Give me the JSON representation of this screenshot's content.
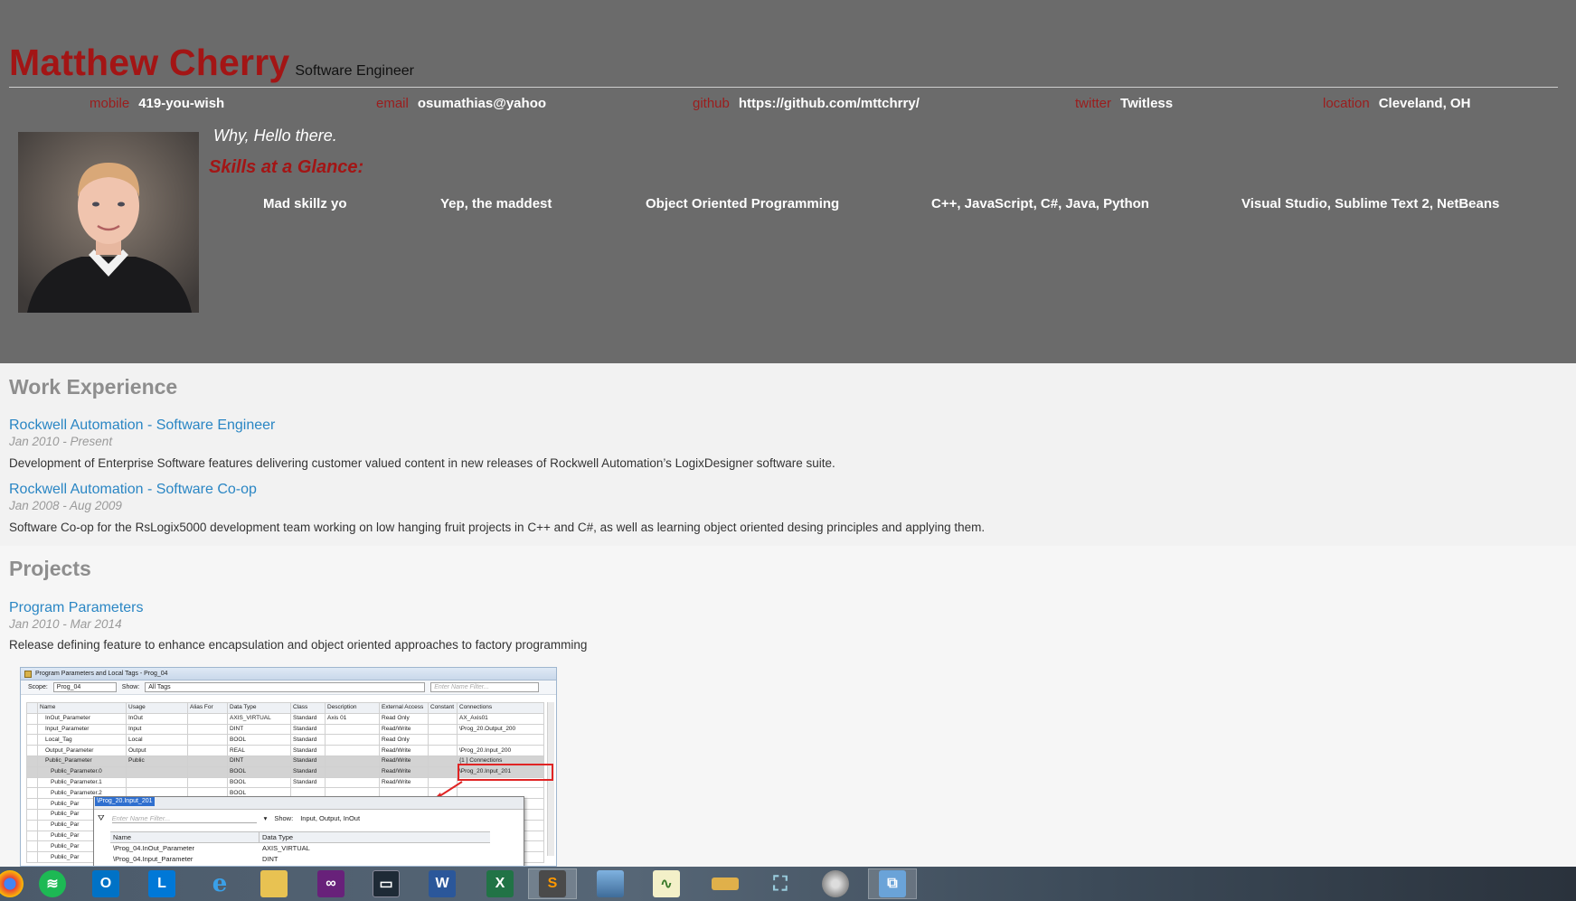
{
  "header": {
    "name": "Matthew Cherry",
    "role": "Software Engineer",
    "contacts": [
      {
        "label": "mobile",
        "value": "419-you-wish"
      },
      {
        "label": "email",
        "value": "osumathias@yahoo"
      },
      {
        "label": "github",
        "value": "https://github.com/mttchrry/"
      },
      {
        "label": "twitter",
        "value": "Twitless"
      },
      {
        "label": "location",
        "value": "Cleveland, OH"
      }
    ],
    "greeting": "Why, Hello there.",
    "skills_title": "Skills at a Glance:",
    "skills": [
      "Mad skillz yo",
      "Yep, the maddest",
      "Object Oriented Programming",
      "C++, JavaScript, C#, Java, Python",
      "Visual Studio, Sublime Text 2, NetBeans"
    ]
  },
  "work": {
    "title": "Work Experience",
    "items": [
      {
        "title": "Rockwell Automation - Software Engineer",
        "date": "Jan 2010 - Present",
        "description": "Development of Enterprise Software features delivering customer valued content in new releases of Rockwell Automation’s LogixDesigner software suite."
      },
      {
        "title": "Rockwell Automation - Software Co-op",
        "date": "Jan 2008 - Aug 2009",
        "description": "Software Co-op for the RsLogix5000 development team working on low hanging fruit projects in C++ and C#, as well as learning object oriented desing principles and applying them."
      }
    ]
  },
  "projects": {
    "title": "Projects",
    "items": [
      {
        "title": "Program Parameters",
        "date": "Jan 2010 - Mar 2014",
        "description": "Release defining feature to enhance encapsulation and object oriented approaches to factory programming"
      }
    ]
  },
  "screenshot": {
    "window_title": "Program Parameters and Local Tags - Prog_04",
    "scope_label": "Scope:",
    "scope_value": "Prog_04",
    "show_label": "Show:",
    "show_value": "All Tags",
    "filter_placeholder": "Enter Name Filter...",
    "columns": [
      "Name",
      "Usage",
      "Alias For",
      "Data Type",
      "Class",
      "Description",
      "External Access",
      "Constant",
      "Connections"
    ],
    "rows": [
      [
        "InOut_Parameter",
        "InOut",
        "",
        "AXIS_VIRTUAL",
        "Standard",
        "Axis 01",
        "Read Only",
        "",
        "AX_Axis01"
      ],
      [
        "Input_Parameter",
        "Input",
        "",
        "DINT",
        "Standard",
        "",
        "Read/Write",
        "",
        "\\Prog_20.Output_200"
      ],
      [
        "Local_Tag",
        "Local",
        "",
        "BOOL",
        "Standard",
        "",
        "Read Only",
        "",
        ""
      ],
      [
        "Output_Parameter",
        "Output",
        "",
        "REAL",
        "Standard",
        "",
        "Read/Write",
        "",
        "\\Prog_20.Input_200"
      ],
      [
        "Public_Parameter",
        "Public",
        "",
        "DINT",
        "Standard",
        "",
        "Read/Write",
        "",
        "{1 ] Connections"
      ],
      [
        "Public_Parameter.0",
        "",
        "",
        "BOOL",
        "Standard",
        "",
        "Read/Write",
        "",
        "\\Prog_20.Input_201"
      ],
      [
        "Public_Parameter.1",
        "",
        "",
        "BOOL",
        "Standard",
        "",
        "Read/Write",
        "",
        ""
      ],
      [
        "Public_Parameter.2",
        "",
        "",
        "BOOL",
        "",
        "",
        "",
        "",
        ""
      ],
      [
        "Public_Par",
        "",
        "",
        "",
        "",
        "",
        "",
        "",
        ""
      ],
      [
        "Public_Par",
        "",
        "",
        "",
        "",
        "",
        "",
        "",
        ""
      ],
      [
        "Public_Par",
        "",
        "",
        "",
        "",
        "",
        "",
        "",
        ""
      ],
      [
        "Public_Par",
        "",
        "",
        "",
        "",
        "",
        "",
        "",
        ""
      ],
      [
        "Public_Par",
        "",
        "",
        "",
        "",
        "",
        "",
        "",
        ""
      ],
      [
        "Public_Par",
        "",
        "",
        "",
        "",
        "",
        "",
        "",
        ""
      ]
    ],
    "popup_edit_value": "\\Prog_20.Input_201",
    "popup_filter_placeholder": "Enter Name Filter...",
    "popup_show_label": "Show:",
    "popup_show_value": "Input, Output, InOut",
    "popup_columns": [
      "Name",
      "Data Type"
    ],
    "popup_rows": [
      [
        "\\Prog_04.InOut_Parameter",
        "AXIS_VIRTUAL"
      ],
      [
        "\\Prog_04.Input_Parameter",
        "DINT"
      ]
    ]
  },
  "taskbar": {
    "icons": [
      "chrome-icon",
      "spotify-icon",
      "outlook-icon",
      "lync-icon",
      "internet-explorer-icon",
      "file-explorer-icon",
      "visual-studio-icon",
      "terminal-icon",
      "word-icon",
      "excel-icon",
      "sublime-text-icon",
      "photos-icon",
      "notepad-icon",
      "rslinx-icon",
      "network-icon",
      "media-icon",
      "remote-desktop-icon"
    ],
    "colors": {
      "spotify": "#1db954",
      "outlook": "#0072c6",
      "lync": "#0078d7",
      "visual_studio": "#68217a",
      "word": "#2b579a",
      "excel": "#217346",
      "sublime": "#ff9800"
    }
  },
  "colors": {
    "header_bg": "#6b6b6b",
    "accent_red": "#a31515",
    "link_blue": "#2a86c4",
    "content_bg": "#f2f2f2"
  }
}
